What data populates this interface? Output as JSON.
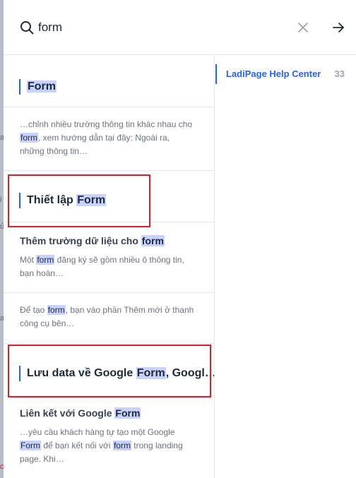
{
  "search": {
    "value": "form",
    "placeholder": ""
  },
  "results": [
    {
      "kind": "section",
      "heading_pre": "",
      "heading_mark": "Form",
      "heading_post": ""
    },
    {
      "kind": "excerpt",
      "line1": "…chỉnh nhiều trường thông tin khác nhau cho",
      "mark1": "form",
      "rest1": ", xem hướng dẫn tại đây: Ngoài ra, những thông tin…"
    },
    {
      "kind": "section",
      "heading_pre": "Thiết lập ",
      "heading_mark": "Form",
      "heading_post": ""
    },
    {
      "kind": "item",
      "title_pre": "Thêm trường dữ liệu cho ",
      "title_mark": "form",
      "ex_pre": "Một ",
      "ex_mark": "form",
      "ex_post": " đăng ký sẽ gồm nhiều ô thông tin, bạn hoàn…"
    },
    {
      "kind": "excerpt2",
      "ex_pre": "Để tạo ",
      "ex_mark": "form",
      "ex_post": ", bạn vào phần Thêm mới ở thanh công cụ bên…"
    },
    {
      "kind": "section",
      "heading_pre": "Lưu data về Google ",
      "heading_mark": "Form",
      "heading_post": ", Googl…"
    },
    {
      "kind": "item",
      "title_pre": "Liên kết với Google ",
      "title_mark": "Form",
      "ex_pre": "…yêu cầu khách hàng tự tạo một Google ",
      "ex_mark": "Form",
      "ex_mid": " để bạn kết nối với ",
      "ex_mark2": "form",
      "ex_post": " trong landing page. Khi…"
    }
  ],
  "sources": [
    {
      "name": "LadiPage Help Center",
      "count": "33"
    }
  ],
  "underlay_chars": [
    "a",
    "i",
    "ủ",
    "a",
    "c"
  ],
  "colors": {
    "accent": "#2563eb",
    "highlight": "#c7d2fe",
    "annotation_red": "#e11d2a"
  }
}
